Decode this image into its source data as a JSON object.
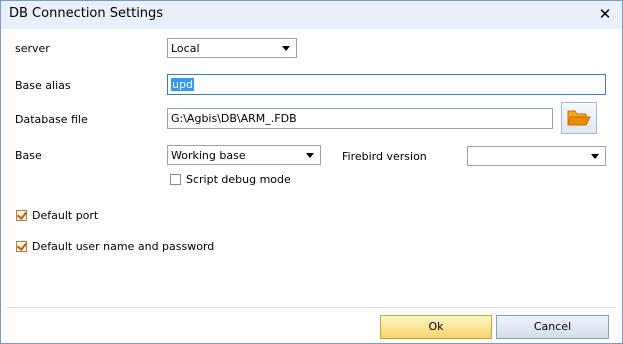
{
  "window": {
    "title": "DB Connection Settings"
  },
  "fields": {
    "server_label": "server",
    "server_value": "Local",
    "base_alias_label": "Base alias",
    "base_alias_value": "upd",
    "database_file_label": "Database file",
    "database_file_value": "G:\\Agbis\\DB\\ARM_.FDB",
    "base_label": "Base",
    "base_value": "Working base",
    "firebird_version_label": "Firebird version",
    "firebird_version_value": ""
  },
  "checkboxes": {
    "script_debug_mode": {
      "label": "Script debug mode",
      "checked": false
    },
    "default_port": {
      "label": "Default port",
      "checked": true
    },
    "default_user": {
      "label": "Default user name and password",
      "checked": true
    }
  },
  "buttons": {
    "ok": "Ok",
    "cancel": "Cancel"
  },
  "icons": {
    "close": "close-icon",
    "folder": "folder-open-icon",
    "dropdown": "chevron-down-icon"
  },
  "colors": {
    "titlebar": "#e8f0fb",
    "ok_button": "#f7d56a",
    "folder": "#f08c00",
    "checkmark": "#c55a11"
  }
}
